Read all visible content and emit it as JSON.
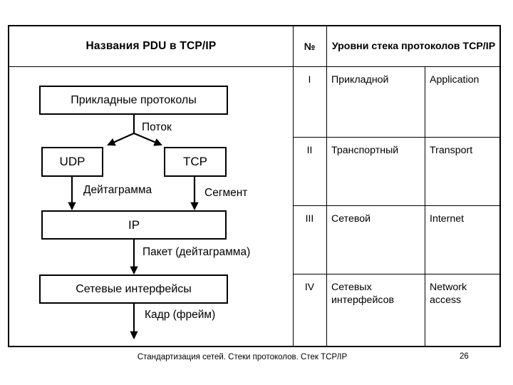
{
  "slide": {
    "table": {
      "header": {
        "left_title": "Названия PDU в TCP/IP",
        "number_col": "№",
        "right_title": "Уровни стека протоколов TCP/IP"
      },
      "rows": [
        {
          "number": "I",
          "level_ru": "Прикладной",
          "level_en": "Application"
        },
        {
          "number": "II",
          "level_ru": "Транспортный",
          "level_en": "Transport"
        },
        {
          "number": "III",
          "level_ru": "Сетевой",
          "level_en": "Internet"
        },
        {
          "number": "IV",
          "level_ru": "Сетевых интерфейсов",
          "level_en": "Network access"
        }
      ]
    },
    "diagram": {
      "boxes": [
        {
          "id": "app",
          "label": "Прикладные протоколы"
        },
        {
          "id": "udp",
          "label": "UDP"
        },
        {
          "id": "tcp",
          "label": "TCP"
        },
        {
          "id": "ip",
          "label": "IP"
        },
        {
          "id": "interfaces",
          "label": "Сетевые интерфейсы"
        }
      ],
      "labels": [
        {
          "id": "stream",
          "text": "Поток"
        },
        {
          "id": "datagram",
          "text": "Дейтаграмма"
        },
        {
          "id": "segment",
          "text": "Сегмент"
        },
        {
          "id": "packet",
          "text": "Пакет (дейтаграмма)"
        },
        {
          "id": "frame",
          "text": "Кадр (фрейм)"
        }
      ]
    },
    "footer": {
      "caption": "Стандартизация сетей. Стеки протоколов. Стек TCP/IP",
      "page_number": "26"
    }
  }
}
